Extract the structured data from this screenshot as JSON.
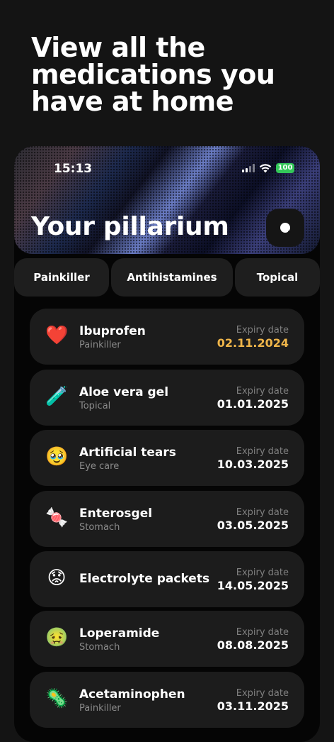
{
  "headline": "View all the medications you have at home",
  "status_bar": {
    "time": "15:13",
    "battery": "100"
  },
  "app_title": "Your pillarium",
  "categories": [
    "Painkiller",
    "Antihistamines",
    "Topical"
  ],
  "expiry_label": "Expiry date",
  "medications": [
    {
      "name": "Ibuprofen",
      "category": "Painkiller",
      "expiry": "02.11.2024",
      "icon": "heart-emoji-icon",
      "glyph": "❤️",
      "expiring_soon": true
    },
    {
      "name": "Aloe vera gel",
      "category": "Topical",
      "expiry": "01.01.2025",
      "icon": "test-tube-emoji-icon",
      "glyph": "🧪"
    },
    {
      "name": "Artificial tears",
      "category": "Eye care",
      "expiry": "10.03.2025",
      "icon": "pleading-face-emoji-icon",
      "glyph": "🥹"
    },
    {
      "name": "Enterosgel",
      "category": "Stomach",
      "expiry": "03.05.2025",
      "icon": "candy-emoji-icon",
      "glyph": "🍬"
    },
    {
      "name": "Electrolyte packets",
      "category": "",
      "expiry": "14.05.2025",
      "icon": "worried-face-emoji-icon",
      "glyph": "😟"
    },
    {
      "name": "Loperamide",
      "category": "Stomach",
      "expiry": "08.08.2025",
      "icon": "nauseated-face-emoji-icon",
      "glyph": "🤢"
    },
    {
      "name": "Acetaminophen",
      "category": "Painkiller",
      "expiry": "03.11.2025",
      "icon": "microbe-emoji-icon",
      "glyph": "🦠"
    }
  ],
  "colors": {
    "background": "#141414",
    "card": "#1c1c1c",
    "warning": "#f0b64a",
    "battery": "#33c759"
  }
}
